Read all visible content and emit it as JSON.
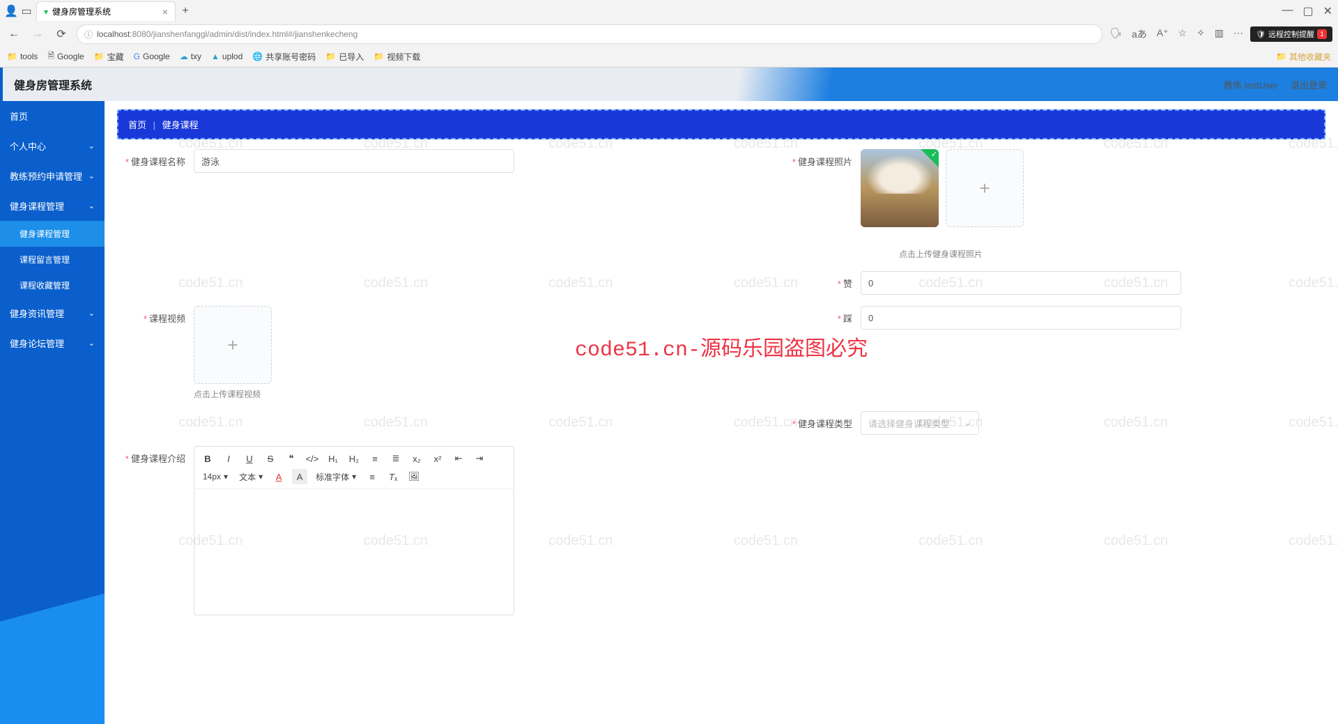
{
  "browser": {
    "tab_title": "健身房管理系统",
    "new_tab": "+",
    "url_host": "localhost",
    "url_port": ":8080",
    "url_path": "/jianshenfanggl/admin/dist/index.html#/jianshenkecheng",
    "remote_notice": "远程控制提醒",
    "remote_count": "1",
    "bookmarks": {
      "tools": "tools",
      "google1": "Google",
      "baozang": "宝藏",
      "google2": "Google",
      "txy": "txy",
      "uplod": "uplod",
      "share": "共享账号密码",
      "imported": "已导入",
      "video": "视频下载",
      "other": "其他收藏夹"
    }
  },
  "app": {
    "title": "健身房管理系统",
    "user_label": "教练 testUser",
    "logout": "退出登录"
  },
  "sidebar": {
    "home": "首页",
    "personal": "个人中心",
    "coach_apply": "教练预约申请管理",
    "course_mgmt": "健身课程管理",
    "course_sub1": "健身课程管理",
    "course_sub2": "课程留言管理",
    "course_sub3": "课程收藏管理",
    "info_mgmt": "健身资讯管理",
    "forum_mgmt": "健身论坛管理"
  },
  "breadcrumb": {
    "home": "首页",
    "current": "健身课程"
  },
  "form": {
    "course_name_label": "健身课程名称",
    "course_name_value": "游泳",
    "course_photo_label": "健身课程照片",
    "photo_hint": "点击上传健身课程照片",
    "video_label": "课程视频",
    "video_hint": "点击上传课程视频",
    "zan_label": "赞",
    "zan_value": "0",
    "cai_label": "踩",
    "cai_value": "0",
    "type_label": "健身课程类型",
    "type_placeholder": "请选择健身课程类型",
    "intro_label": "健身课程介绍"
  },
  "editor": {
    "font_size": "14px",
    "para": "文本",
    "font_family": "标准字体"
  },
  "watermark": "code51.cn",
  "center_text": "code51.cn-源码乐园盗图必究"
}
